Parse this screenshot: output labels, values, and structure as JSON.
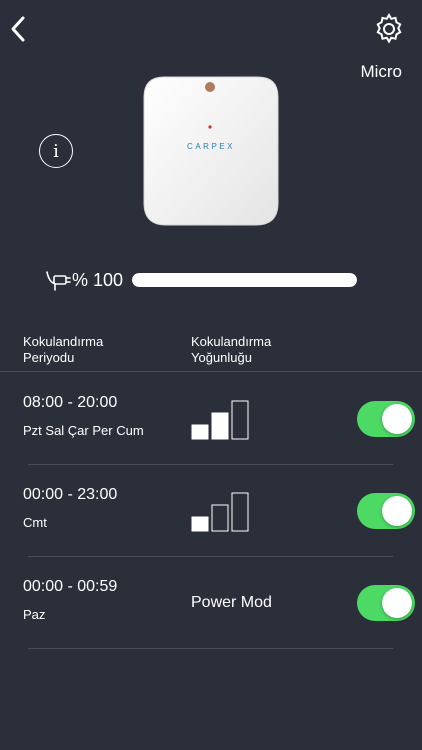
{
  "header": {
    "back_icon": "chevron-left-icon",
    "settings_icon": "gear-icon",
    "device_name": "Micro"
  },
  "device": {
    "brand": "CARPEX",
    "info_icon": "info-icon",
    "info_glyph": "i"
  },
  "battery": {
    "icon": "plug-icon",
    "label": "% 100",
    "level_percent": 100
  },
  "columns": {
    "period": "Kokulandırma Periyodu",
    "intensity": "Kokulandırma Yoğunluğu"
  },
  "schedules": [
    {
      "time": "08:00 - 20:00",
      "days": "Pzt Sal Çar Per Cum",
      "intensity_level": 2,
      "intensity_max": 3,
      "power_mode_label": "",
      "enabled": true
    },
    {
      "time": "00:00 - 23:00",
      "days": "Cmt",
      "intensity_level": 1,
      "intensity_max": 3,
      "power_mode_label": "",
      "enabled": true
    },
    {
      "time": "00:00 - 00:59",
      "days": "Paz",
      "intensity_level": null,
      "intensity_max": 3,
      "power_mode_label": "Power Mod",
      "enabled": true
    }
  ],
  "colors": {
    "background": "#2b2f3a",
    "toggle_on": "#4cd964",
    "text": "#ffffff"
  }
}
